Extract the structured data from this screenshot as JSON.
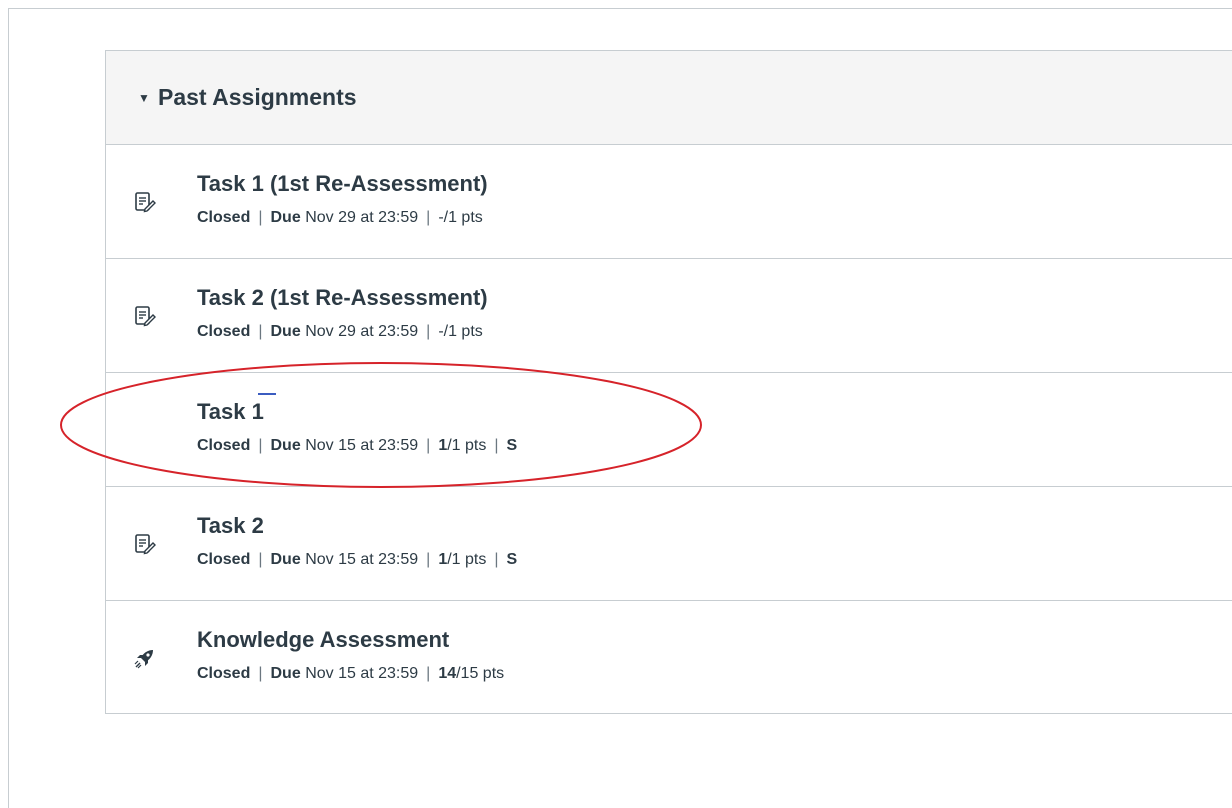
{
  "section": {
    "title": "Past Assignments",
    "caret_icon": "caret-down-icon"
  },
  "assignments": [
    {
      "title": "Task 1 (1st Re-Assessment)",
      "icon": "assignment-icon",
      "status": "Closed",
      "due_label": "Due",
      "due_date": "Nov 29 at 23:59",
      "score": "-",
      "points": "/1 pts",
      "grade": ""
    },
    {
      "title": "Task 2 (1st Re-Assessment)",
      "icon": "assignment-icon",
      "status": "Closed",
      "due_label": "Due",
      "due_date": "Nov 29 at 23:59",
      "score": "-",
      "points": "/1 pts",
      "grade": ""
    },
    {
      "title": "Task 1",
      "icon": "",
      "status": "Closed",
      "due_label": "Due",
      "due_date": "Nov 15 at 23:59",
      "score": "1",
      "points": "/1 pts",
      "grade": "S"
    },
    {
      "title": "Task 2",
      "icon": "assignment-icon",
      "status": "Closed",
      "due_label": "Due",
      "due_date": "Nov 15 at 23:59",
      "score": "1",
      "points": "/1 pts",
      "grade": "S"
    },
    {
      "title": "Knowledge Assessment",
      "icon": "quiz-rocket-icon",
      "status": "Closed",
      "due_label": "Due",
      "due_date": "Nov 15 at 23:59",
      "score": "14",
      "points": "/15 pts",
      "grade": ""
    }
  ],
  "separator": "|",
  "colors": {
    "text": "#2d3b45",
    "border": "#c7cdd1",
    "header_bg": "#f5f5f5",
    "annotation": "#d6232a"
  }
}
